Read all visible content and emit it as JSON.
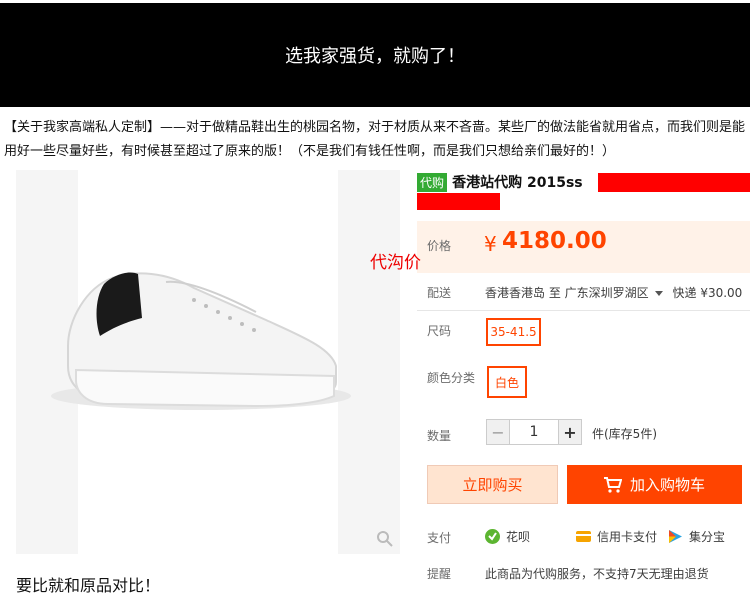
{
  "banner": {
    "text": "选我家强货，就购了！"
  },
  "intro": {
    "text": "【关于我家高端私人定制】——对于做精品鞋出生的桃园名物，对于材质从来不吝啬。某些厂的做法能省就用省点，而我们则是能用好一些尽量好些，有时候甚至超过了原来的版！（不是我们有钱任性啊，而是我们只想给亲们最好的！）"
  },
  "product": {
    "tag": "代购",
    "title": "香港站代购 2015ss",
    "compare_note": "要比就和原品对比！",
    "daigou_note": "代沟价"
  },
  "price": {
    "label": "价格",
    "currency": "¥",
    "value": "4180.00"
  },
  "shipping": {
    "label": "配送",
    "from": "香港香港岛 至",
    "to": "广东深圳罗湖区",
    "method": "快递 ¥30.00"
  },
  "size": {
    "label": "尺码",
    "selected": "35-41.5"
  },
  "color": {
    "label": "颜色分类",
    "selected": "白色"
  },
  "quantity": {
    "label": "数量",
    "minus": "−",
    "value": "1",
    "plus": "+",
    "stock": "件(库存5件)"
  },
  "actions": {
    "buy_now": "立即购买",
    "add_cart": "加入购物车"
  },
  "payment": {
    "label": "支付",
    "methods": [
      "花呗",
      "信用卡支付",
      "集分宝"
    ]
  },
  "notice": {
    "label": "提醒",
    "text": "此商品为代购服务，不支持7天无理由退货"
  },
  "colors": {
    "accent": "#ff4400",
    "price_bg": "#fff2e8",
    "tag_green": "#33aa33",
    "redaction": "#ff0000"
  }
}
